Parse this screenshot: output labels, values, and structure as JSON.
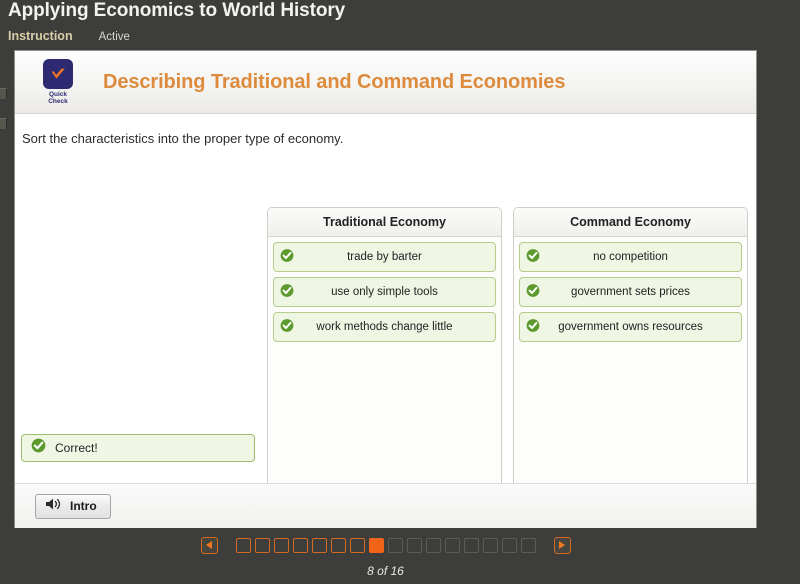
{
  "topbar": {
    "lesson_title": "Applying Economics to World History",
    "tabs": [
      {
        "label": "Instruction",
        "state": "active"
      },
      {
        "label": "Active",
        "state": "secondary"
      }
    ]
  },
  "activity": {
    "badge": {
      "icon": "check-badge-icon",
      "line1": "Quick",
      "line2": "Check",
      "square_color": "#2e2a72",
      "check_color": "#ee7623"
    },
    "title": "Describing Traditional and Command Economies",
    "title_color": "#dd8b3d",
    "prompt": "Sort the characteristics into the proper type of economy."
  },
  "columns": [
    {
      "header": "Traditional Economy",
      "items": [
        {
          "label": "trade by barter",
          "status_icon": "green-check-icon"
        },
        {
          "label": "use only simple tools",
          "status_icon": "green-check-icon"
        },
        {
          "label": "work methods change little",
          "status_icon": "green-check-icon"
        }
      ]
    },
    {
      "header": "Command Economy",
      "items": [
        {
          "label": "no competition",
          "status_icon": "green-check-icon"
        },
        {
          "label": "government sets prices",
          "status_icon": "green-check-icon"
        },
        {
          "label": "government owns resources",
          "status_icon": "green-check-icon"
        }
      ]
    }
  ],
  "feedback": {
    "icon": "green-check-icon",
    "text": "Correct!",
    "background": "#f0f6e4",
    "border": "#9dbb6a"
  },
  "footer": {
    "intro_button": {
      "icon": "speaker-icon",
      "label": "Intro"
    }
  },
  "pagination": {
    "prev_icon": "arrow-left-icon",
    "next_icon": "arrow-right-icon",
    "current": 8,
    "total": 16,
    "counter_text": "8 of 16",
    "visited_color": "#d26a24",
    "current_color": "#f2641a",
    "future_color": "#5c5c57"
  }
}
